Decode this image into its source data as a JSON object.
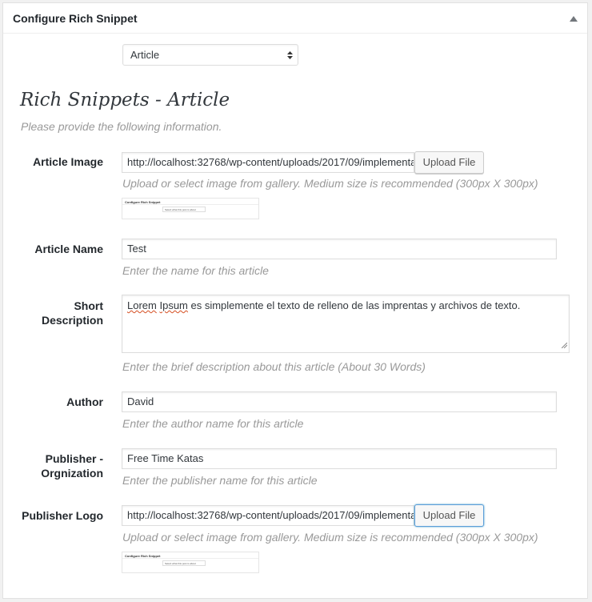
{
  "panel": {
    "title": "Configure Rich Snippet",
    "toggle_icon": "triangle-up-icon"
  },
  "schema_select": {
    "value": "Article"
  },
  "section": {
    "title": "Rich Snippets - Article",
    "description": "Please provide the following information."
  },
  "fields": {
    "article_image": {
      "label": "Article Image",
      "value": "http://localhost:32768/wp-content/uploads/2017/09/implementa",
      "button": "Upload File",
      "help": "Upload or select image from gallery. Medium size is recommended (300px X 300px)"
    },
    "article_name": {
      "label": "Article Name",
      "value": "Test",
      "help": "Enter the name for this article"
    },
    "short_description": {
      "label_line1": "Short",
      "label_line2": "Description",
      "value_first_word": "Lorem",
      "value_second_word": "Ipsum",
      "value_rest": " es simplemente el texto de relleno de las imprentas y archivos de texto.",
      "help": "Enter the brief description about this article (About 30 Words)"
    },
    "author": {
      "label": "Author",
      "value": "David",
      "help": "Enter the author name for this article"
    },
    "publisher_org": {
      "label_line1": "Publisher -",
      "label_line2": "Orgnization",
      "value": "Free Time Katas",
      "help": "Enter the publisher name for this article"
    },
    "publisher_logo": {
      "label": "Publisher Logo",
      "value": "http://localhost:32768/wp-content/uploads/2017/09/implementa",
      "button": "Upload File",
      "help": "Upload or select image from gallery. Medium size is recommended (300px X 300px)"
    }
  },
  "thumbnail": {
    "title": "Configure Rich Snippet",
    "select_text": "Select what this post is about"
  }
}
